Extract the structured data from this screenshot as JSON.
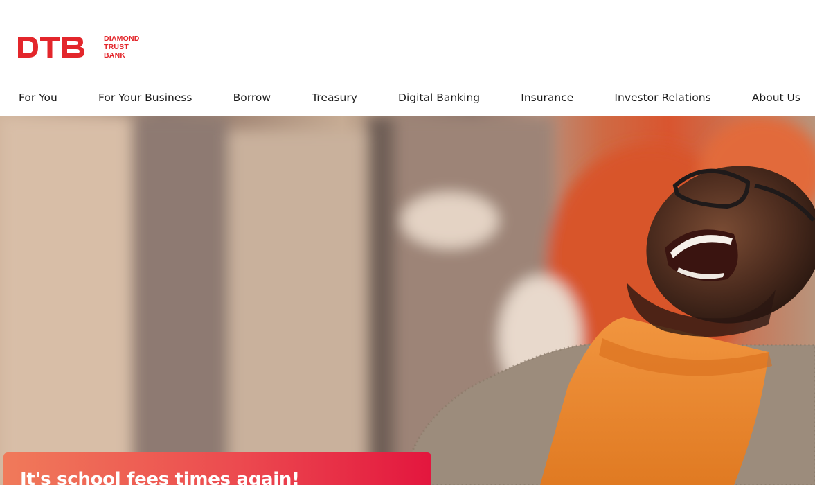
{
  "brand": {
    "logo_mark": "DTB",
    "logo_name_lines": [
      "DIAMOND",
      "TRUST",
      "BANK"
    ],
    "color": "#e3262b"
  },
  "nav": {
    "items": [
      {
        "label": "For You"
      },
      {
        "label": "For Your Business"
      },
      {
        "label": "Borrow"
      },
      {
        "label": "Treasury"
      },
      {
        "label": "Digital Banking"
      },
      {
        "label": "Insurance"
      },
      {
        "label": "Investor Relations"
      },
      {
        "label": "About Us"
      }
    ]
  },
  "hero": {
    "image": "laughing-man-photo",
    "promo_title": "It's school fees times again!",
    "promo_colors": [
      "#f07a5a",
      "#e3163e"
    ]
  }
}
